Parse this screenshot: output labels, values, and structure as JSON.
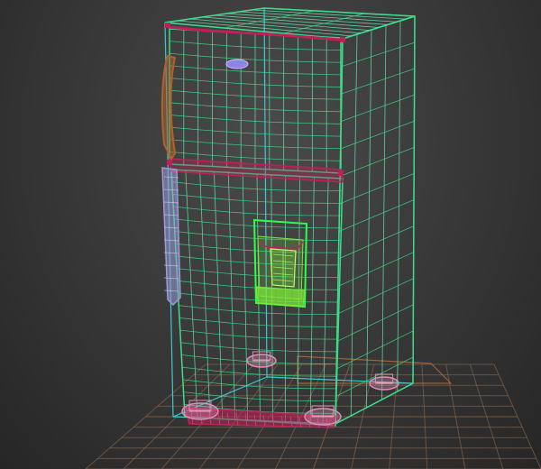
{
  "viewport": {
    "view": "perspective",
    "shading": "wireframe",
    "background_color": "#3a3a3a"
  },
  "colors": {
    "grid_line": "#8e6a50",
    "grid_center": "#b07040",
    "bounding_box": "#3fc6d8",
    "cabinet_wire": "#3ddc8a",
    "cabinet_wire_light": "#66e8b0",
    "door_seal": "#c0205a",
    "upper_handle": "#b0622c",
    "lower_handle": "#9b9bd8",
    "dispenser": "#7de83a",
    "dispenser_frame": "#2cff4a",
    "feet": "#e090b8",
    "logo": "#8f84e6"
  },
  "object": {
    "name": "refrigerator",
    "parts": [
      "freezer-door",
      "fresh-food-door",
      "water-dispenser",
      "door-handles",
      "leveling-feet",
      "bottom-grille",
      "logo-badge"
    ]
  }
}
